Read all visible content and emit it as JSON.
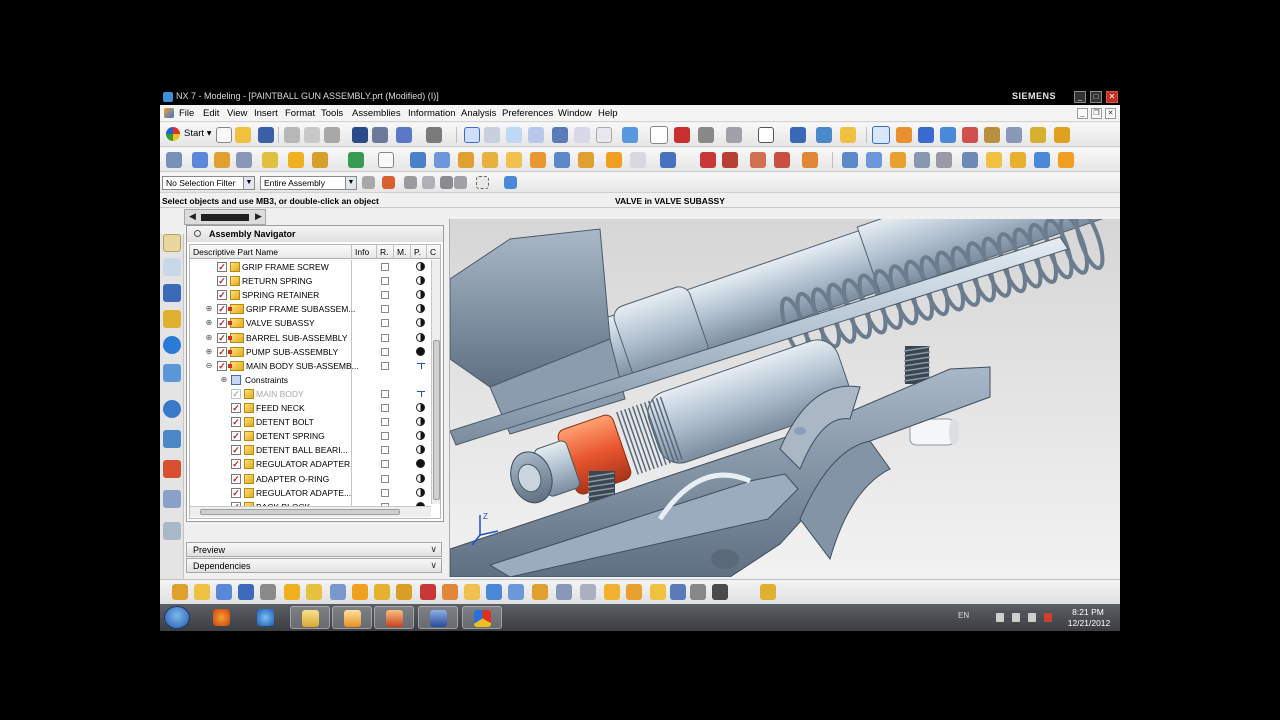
{
  "window": {
    "title": "NX 7 - Modeling - [PAINTBALL GUN ASSEMBLY.prt (Modified)   (I)]",
    "brand": "SIEMENS",
    "minimize": "_",
    "maximize": "□",
    "close": "✕",
    "doc_minimize": "_",
    "doc_restore": "❐",
    "doc_close": "✕"
  },
  "menu": {
    "items": [
      "File",
      "Edit",
      "View",
      "Insert",
      "Format",
      "Tools",
      "Assemblies",
      "Information",
      "Analysis",
      "Preferences",
      "Window",
      "Help"
    ]
  },
  "toolbar": {
    "start_label": "Start",
    "selection_filter": "No Selection Filter",
    "scope": "Entire Assembly"
  },
  "status": {
    "prompt": "Select objects and use MB3, or double-click an object",
    "selection_info": "VALVE in VALVE SUBASSY"
  },
  "navigator": {
    "title": "Assembly Navigator",
    "scroll_left": "◀",
    "scroll_right": "▶",
    "columns": {
      "name": "Descriptive Part Name",
      "info": "Info",
      "ref": "R.",
      "mod": "M.",
      "pos": "P.",
      "c": "C"
    },
    "rows": [
      {
        "name": "GRIP FRAME SCREW",
        "pos": "half"
      },
      {
        "name": "RETURN SPRING",
        "pos": "half"
      },
      {
        "name": "SPRING RETAINER",
        "pos": "half"
      },
      {
        "name": "GRIP FRAME SUBASSEM...",
        "pos": "half",
        "expander": "+"
      },
      {
        "name": "VALVE SUBASSY",
        "pos": "half",
        "expander": "+"
      },
      {
        "name": "BARREL SUB-ASSEMBLY",
        "pos": "half",
        "expander": "+"
      },
      {
        "name": "PUMP SUB-ASSEMBLY",
        "pos": "full",
        "expander": "+"
      },
      {
        "name": "MAIN BODY SUB-ASSEMB...",
        "pos": "arrow",
        "expander": "−"
      },
      {
        "name": "Constraints",
        "pos": "none",
        "expander": "+"
      },
      {
        "name": "MAIN BODY",
        "pos": "arrow"
      },
      {
        "name": "FEED NECK",
        "pos": "half"
      },
      {
        "name": "DETENT BOLT",
        "pos": "half"
      },
      {
        "name": "DETENT SPRING",
        "pos": "half"
      },
      {
        "name": "DETENT BALL BEARI...",
        "pos": "half"
      },
      {
        "name": "REGULATOR ADAPTER",
        "pos": "full"
      },
      {
        "name": "ADAPTER O-RING",
        "pos": "half"
      },
      {
        "name": "REGULATOR ADAPTE...",
        "pos": "half"
      },
      {
        "name": "BACK BLOCK",
        "pos": "full"
      }
    ]
  },
  "panels": {
    "preview": "Preview",
    "dependencies": "Dependencies",
    "chevron": "∨"
  },
  "taskbar": {
    "language": "EN",
    "time": "8:21 PM",
    "date": "12/21/2012"
  },
  "icons": {
    "app": "nx-app-icon",
    "start": "start-icon",
    "pin": "pin-icon",
    "part": "part-icon",
    "assembly": "assembly-icon",
    "constraint": "constraints-icon"
  },
  "colors": {
    "accent_orange": "#e8562e",
    "steel_blue": "#a4b6c8"
  }
}
